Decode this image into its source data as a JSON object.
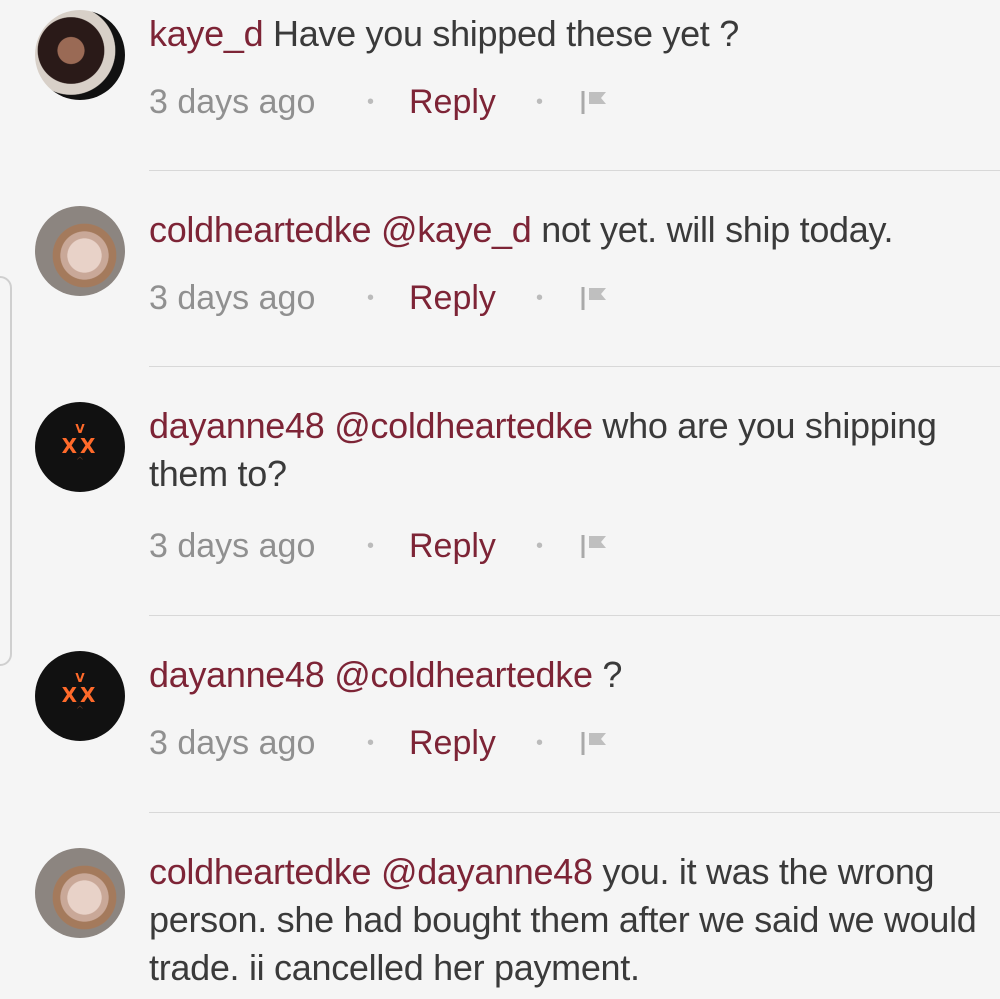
{
  "comments": [
    {
      "username": "kaye_d",
      "mention": "",
      "text": " Have you shipped these yet ?",
      "time": "3 days ago",
      "reply_label": "Reply",
      "avatar_icon": "user-avatar-photo"
    },
    {
      "username": "coldheartedke",
      "mention": "@kaye_d",
      "text": " not yet. will ship today.",
      "time": "3 days ago",
      "reply_label": "Reply",
      "avatar_icon": "user-avatar-photo"
    },
    {
      "username": "dayanne48",
      "mention": "@coldheartedke",
      "text": " who are you shipping them to?",
      "time": "3 days ago",
      "reply_label": "Reply",
      "avatar_icon": "xx-face-avatar"
    },
    {
      "username": "dayanne48",
      "mention": "@coldheartedke",
      "text": " ?",
      "time": "3 days ago",
      "reply_label": "Reply",
      "avatar_icon": "xx-face-avatar"
    },
    {
      "username": "coldheartedke",
      "mention": "@dayanne48",
      "text": " you. it was the wrong person. she had bought them after we said we would trade. ii cancelled her payment.",
      "time": "",
      "reply_label": "",
      "avatar_icon": "user-avatar-photo"
    }
  ],
  "colors": {
    "accent": "#7d2436",
    "text": "#3a3a3a",
    "muted": "#909090",
    "background": "#f5f5f5"
  }
}
